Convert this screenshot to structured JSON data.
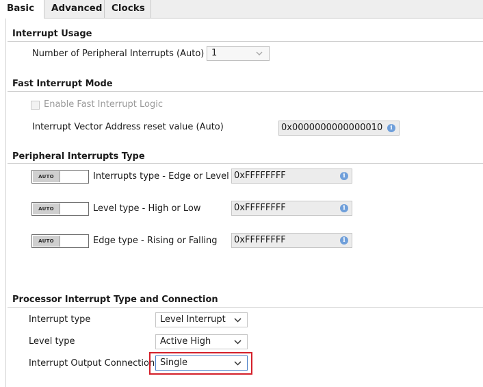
{
  "tabs": [
    {
      "label": "Basic",
      "active": true
    },
    {
      "label": "Advanced",
      "active": false
    },
    {
      "label": "Clocks",
      "active": false
    }
  ],
  "interrupt_usage": {
    "title": "Interrupt Usage",
    "num_peripheral_label": "Number of Peripheral Interrupts (Auto)",
    "num_peripheral_value": "1"
  },
  "fast_interrupt": {
    "title": "Fast Interrupt Mode",
    "enable_label": "Enable Fast Interrupt Logic",
    "enable_checked": false,
    "vector_label": "Interrupt Vector Address reset value (Auto)",
    "vector_value": "0x0000000000000010"
  },
  "peripheral_type": {
    "title": "Peripheral Interrupts Type",
    "auto_text": "AUTO",
    "rows": [
      {
        "label": "Interrupts type - Edge or Level",
        "value": "0xFFFFFFFF"
      },
      {
        "label": "Level type - High or Low",
        "value": "0xFFFFFFFF"
      },
      {
        "label": "Edge type - Rising or Falling",
        "value": "0xFFFFFFFF"
      }
    ]
  },
  "processor": {
    "title": "Processor Interrupt Type and Connection",
    "interrupt_type_label": "Interrupt type",
    "interrupt_type_value": "Level Interrupt",
    "level_type_label": "Level type",
    "level_type_value": "Active High",
    "output_conn_label": "Interrupt Output Connection",
    "output_conn_value": "Single"
  },
  "colors": {
    "highlight": "#d4202a",
    "info_icon": "#6f9fda",
    "focus_border": "#4a7fc8"
  }
}
